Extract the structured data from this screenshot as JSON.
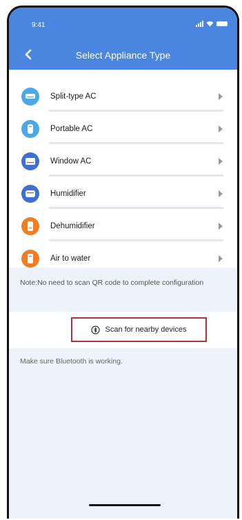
{
  "status_bar": {
    "time": "9:41"
  },
  "nav": {
    "title": "Select Appliance Type",
    "back_icon": "chevron-left-icon"
  },
  "appliances": [
    {
      "label": "Split-type AC",
      "icon": "split-ac-icon",
      "color": "#4aa8e8"
    },
    {
      "label": "Portable AC",
      "icon": "portable-ac-icon",
      "color": "#4aa8e8"
    },
    {
      "label": "Window AC",
      "icon": "window-ac-icon",
      "color": "#3f6fd0"
    },
    {
      "label": "Humidifier",
      "icon": "humidifier-icon",
      "color": "#3f6fd0"
    },
    {
      "label": "Dehumidifier",
      "icon": "dehumidifier-icon",
      "color": "#f07d22"
    },
    {
      "label": "Air to water",
      "icon": "air-to-water-icon",
      "color": "#f07d22"
    }
  ],
  "note": "Note:No need to scan QR code to complete configuration",
  "scan": {
    "label": "Scan for nearby devices",
    "icon": "bluetooth-scan-icon"
  },
  "bluetooth_note": "Make sure Bluetooth is working.",
  "colors": {
    "header": "#4a86e0",
    "background": "#edf1fa",
    "scan_border": "#b0303a"
  }
}
